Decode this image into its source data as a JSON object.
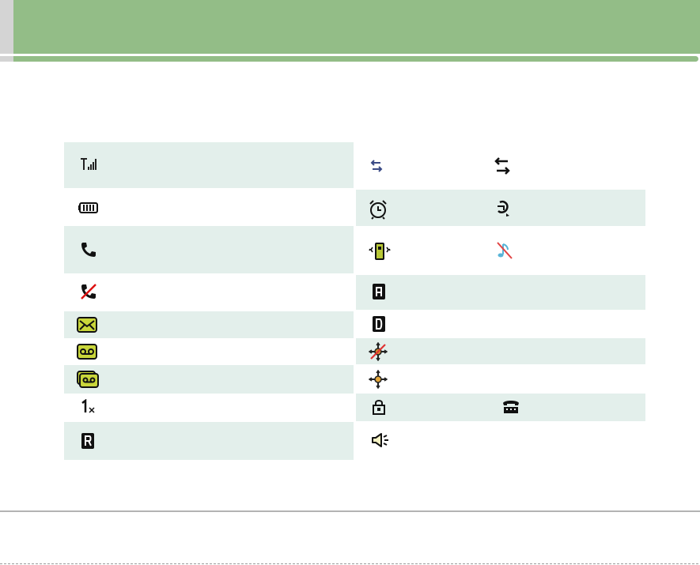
{
  "page": {
    "header_color": "#93bd87",
    "shade_color": "#e3efeb"
  },
  "icons_left": [
    {
      "name": "signal-strength-icon"
    },
    {
      "name": "battery-icon"
    },
    {
      "name": "call-in-progress-icon"
    },
    {
      "name": "no-service-icon"
    },
    {
      "name": "new-text-message-icon"
    },
    {
      "name": "new-voicemail-icon"
    },
    {
      "name": "text-and-voicemail-icon"
    },
    {
      "name": "1x-service-icon"
    },
    {
      "name": "roaming-icon"
    }
  ],
  "icons_right": [
    {
      "name": "data-transfer-icon",
      "name2": "data-dormant-icon"
    },
    {
      "name": "alarm-clock-icon",
      "name2": "call-forward-icon"
    },
    {
      "name": "vibrate-mode-icon",
      "name2": "silent-mode-icon"
    },
    {
      "name": "auto-answer-icon"
    },
    {
      "name": "digital-mode-icon"
    },
    {
      "name": "location-off-icon"
    },
    {
      "name": "location-on-icon"
    },
    {
      "name": "lock-icon",
      "name2": "tty-icon"
    },
    {
      "name": "speakerphone-icon"
    }
  ]
}
